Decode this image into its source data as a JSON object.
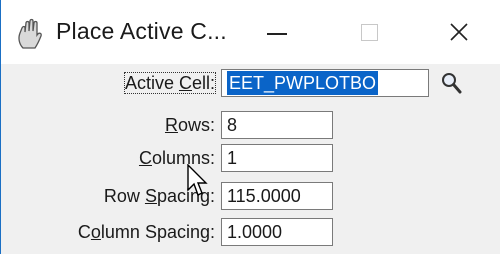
{
  "window": {
    "title": "Place Active C...",
    "app_icon": "microstation-hand-icon",
    "minimize_icon": "minimize-icon",
    "maximize_icon": "maximize-icon",
    "close_icon": "close-icon",
    "close_glyph": "✕"
  },
  "form": {
    "active_cell": {
      "label_pre": "Active ",
      "label_ul": "C",
      "label_post": "ell:",
      "value": "EET_PWPLOTBO",
      "selected": true,
      "search_icon": "magnifier-icon"
    },
    "rows": {
      "label_pre": "",
      "label_ul": "R",
      "label_post": "ows:",
      "value": "8"
    },
    "columns": {
      "label_pre": "",
      "label_ul": "C",
      "label_post": "olumns:",
      "value": "1"
    },
    "row_spacing": {
      "label_pre": "Row ",
      "label_ul": "S",
      "label_post": "pacing:",
      "value": "115.0000"
    },
    "column_spacing": {
      "label_pre": "C",
      "label_ul": "o",
      "label_post": "lumn Spacing:",
      "value": "1.0000"
    }
  },
  "colors": {
    "selection": "#0a64c8",
    "window_border": "#1a6fc4",
    "dialog_bg": "#f0f0f0"
  }
}
